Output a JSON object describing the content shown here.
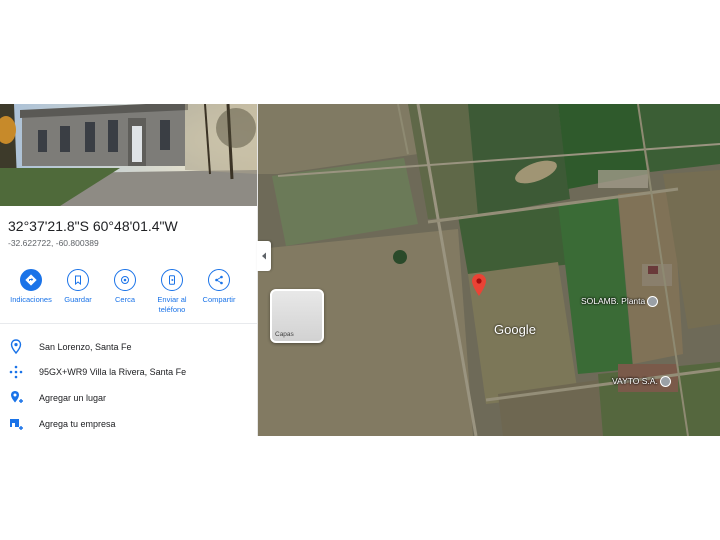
{
  "place": {
    "coordinates": "32°37'21.8\"S 60°48'01.4\"W",
    "decimal": "-32.622722, -60.800389"
  },
  "actions": [
    {
      "label": "Indicaciones",
      "icon": "directions-icon"
    },
    {
      "label": "Guardar",
      "icon": "bookmark-icon"
    },
    {
      "label": "Cerca",
      "icon": "nearby-icon"
    },
    {
      "label": "Enviar al\nteléfono",
      "icon": "phone-send-icon"
    },
    {
      "label": "Compartir",
      "icon": "share-icon"
    }
  ],
  "info_rows": [
    {
      "text": "San Lorenzo, Santa Fe",
      "icon": "location-pin-icon"
    },
    {
      "text": "95GX+WR9 Villa la Rivera, Santa Fe",
      "icon": "plus-code-icon"
    },
    {
      "text": "Agregar un lugar",
      "icon": "add-place-icon"
    },
    {
      "text": "Agrega tu empresa",
      "icon": "add-business-icon"
    }
  ],
  "map": {
    "labels": [
      {
        "text": "SOLAMB. Planta"
      },
      {
        "text": "VAYTO S.A."
      }
    ],
    "layers_label": "Capas",
    "watermark": "Google"
  },
  "colors": {
    "accent": "#1a73e8",
    "pin": "#ea4335"
  }
}
